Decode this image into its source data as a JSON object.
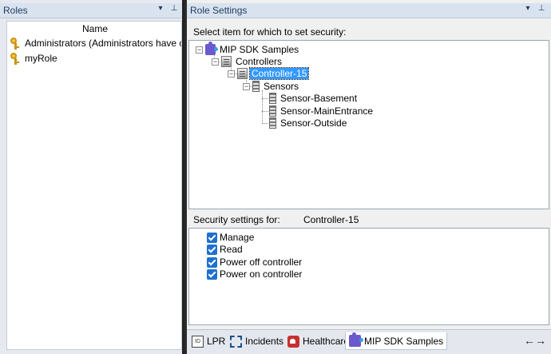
{
  "roles_pane": {
    "title": "Roles",
    "dropdown_glyph": "▾",
    "pin_glyph": "⊥",
    "column_header": "Name",
    "items": [
      {
        "label": "Administrators (Administrators have co",
        "icon": "key-icon"
      },
      {
        "label": "myRole",
        "icon": "key-icon"
      }
    ]
  },
  "role_settings": {
    "title": "Role Settings",
    "dropdown_glyph": "▾",
    "pin_glyph": "⊥",
    "select_label": "Select item for which to set security:",
    "tree": {
      "root": "MIP SDK Samples",
      "controllers": "Controllers",
      "controller": "Controller-15",
      "sensors": "Sensors",
      "sensor_items": [
        "Sensor-Basement",
        "Sensor-MainEntrance",
        "Sensor-Outside"
      ],
      "expander_glyph": "−"
    },
    "security_for_label": "Security settings for:",
    "security_for_value": "Controller-15",
    "permissions": [
      {
        "label": "Manage",
        "checked": true
      },
      {
        "label": "Read",
        "checked": true
      },
      {
        "label": "Power off controller",
        "checked": true
      },
      {
        "label": "Power on controller",
        "checked": true
      }
    ]
  },
  "tabs": [
    {
      "label": "LPR",
      "icon": "lpr-icon"
    },
    {
      "label": "Incidents",
      "icon": "incidents-icon"
    },
    {
      "label": "Healthcare",
      "icon": "healthcare-icon"
    },
    {
      "label": "MIP SDK Samples",
      "icon": "puzzle-icon",
      "active": true
    }
  ],
  "tab_scroll_glyph": "←→",
  "colors": {
    "selection": "#3399ff",
    "checkbox": "#1f6fd1",
    "header_bg": "#d9e3ef"
  }
}
